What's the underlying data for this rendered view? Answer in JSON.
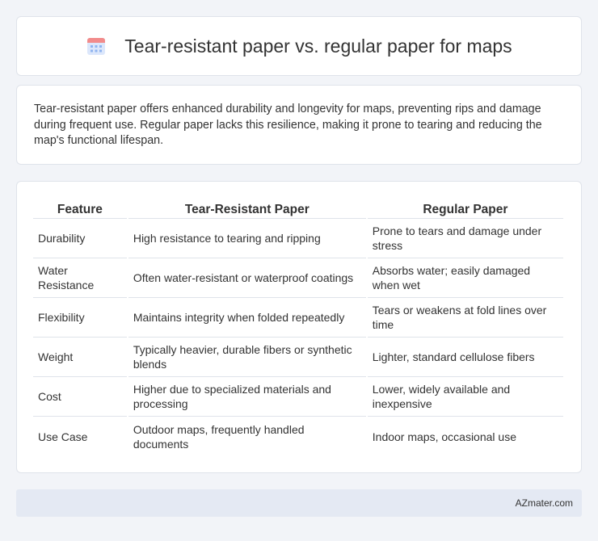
{
  "header": {
    "title": "Tear-resistant paper vs. regular paper for maps",
    "icon": "calendar-icon"
  },
  "summary": {
    "text": "Tear-resistant paper offers enhanced durability and longevity for maps, preventing rips and damage during frequent use. Regular paper lacks this resilience, making it prone to tearing and reducing the map's functional lifespan."
  },
  "table": {
    "headers": [
      "Feature",
      "Tear-Resistant Paper",
      "Regular Paper"
    ],
    "rows": [
      [
        "Durability",
        "High resistance to tearing and ripping",
        "Prone to tears and damage under stress"
      ],
      [
        "Water Resistance",
        "Often water-resistant or waterproof coatings",
        "Absorbs water; easily damaged when wet"
      ],
      [
        "Flexibility",
        "Maintains integrity when folded repeatedly",
        "Tears or weakens at fold lines over time"
      ],
      [
        "Weight",
        "Typically heavier, durable fibers or synthetic blends",
        "Lighter, standard cellulose fibers"
      ],
      [
        "Cost",
        "Higher due to specialized materials and processing",
        "Lower, widely available and inexpensive"
      ],
      [
        "Use Case",
        "Outdoor maps, frequently handled documents",
        "Indoor maps, occasional use"
      ]
    ]
  },
  "footer": {
    "brand": "AZmater.com"
  },
  "colors": {
    "background": "#f2f4f8",
    "card": "#ffffff",
    "border": "#dfe3ea",
    "footer": "#e4e9f3",
    "icon_top": "#f28b8b",
    "icon_body": "#8fb4f0"
  }
}
